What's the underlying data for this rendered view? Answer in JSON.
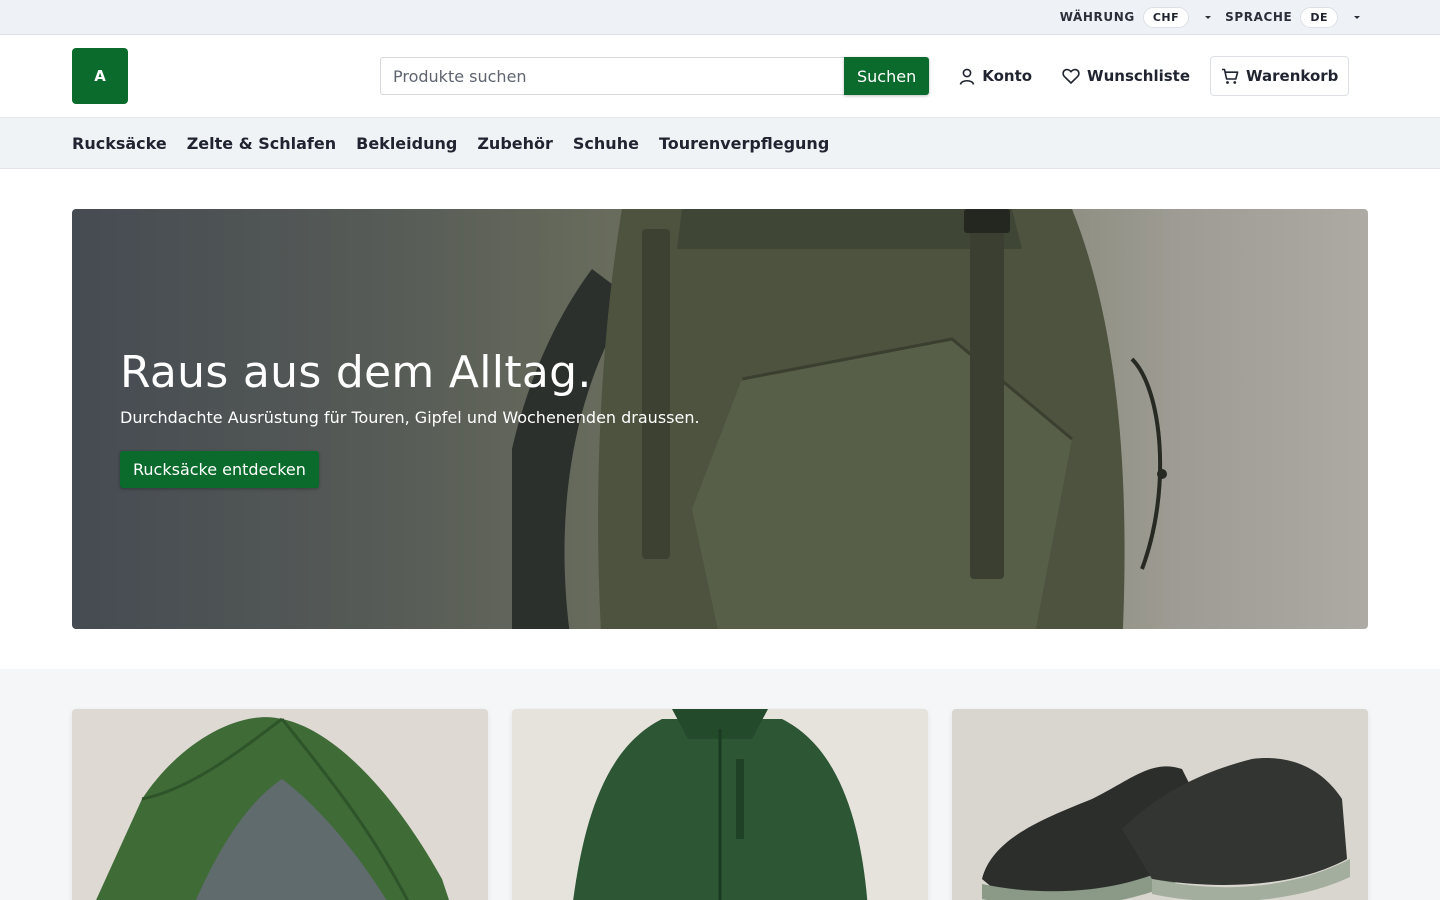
{
  "utility": {
    "currency_label": "WÄHRUNG",
    "currency_value": "CHF",
    "language_label": "SPRACHE",
    "language_value": "DE"
  },
  "header": {
    "logo_text": "A",
    "search_placeholder": "Produkte suchen",
    "search_button": "Suchen",
    "account": "Konto",
    "wishlist": "Wunschliste",
    "cart": "Warenkorb"
  },
  "nav": {
    "categories": [
      "Rucksäcke",
      "Zelte & Schlafen",
      "Bekleidung",
      "Zubehör",
      "Schuhe",
      "Tourenverpflegung"
    ]
  },
  "hero": {
    "title": "Raus aus dem Alltag.",
    "subtitle": "Durchdachte Ausrüstung für Touren, Gipfel und Wochenenden draussen.",
    "cta": "Rucksäcke entdecken"
  },
  "colors": {
    "brand": "#0a6b2c",
    "utility_bg": "#eef1f5",
    "nav_bg": "#f0f3f6"
  },
  "icons": {
    "account": "user-icon",
    "wishlist": "heart-icon",
    "cart": "cart-icon"
  }
}
